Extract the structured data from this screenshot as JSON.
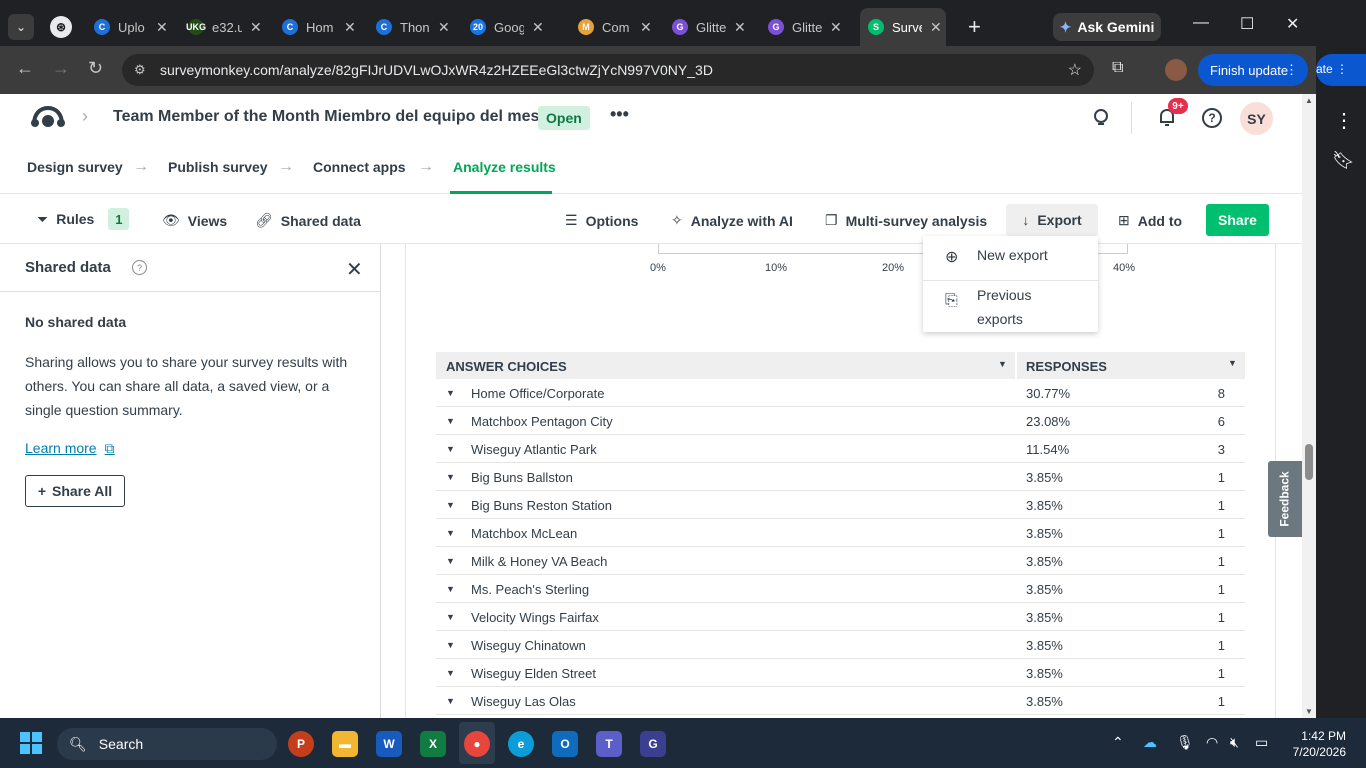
{
  "browser": {
    "tabs": [
      {
        "title": "Uplo",
        "fav_color": "#1e6fd8",
        "fav_glyph": "C"
      },
      {
        "title": "e32.u",
        "fav_color": "#234b1a",
        "fav_glyph": "UKG"
      },
      {
        "title": "Hom",
        "fav_color": "#1e6fd8",
        "fav_glyph": "C"
      },
      {
        "title": "Thon",
        "fav_color": "#1e6fd8",
        "fav_glyph": "C"
      },
      {
        "title": "Goog",
        "fav_color": "#1a73e8",
        "fav_glyph": "20"
      },
      {
        "title": "Com",
        "fav_color": "#e8a13a",
        "fav_glyph": "M"
      },
      {
        "title": "Glitte",
        "fav_color": "#7b4fd6",
        "fav_glyph": "G"
      },
      {
        "title": "Glitte",
        "fav_color": "#7b4fd6",
        "fav_glyph": "G"
      },
      {
        "title": "Surve",
        "fav_color": "#00bf6f",
        "fav_glyph": "S",
        "active": true
      }
    ],
    "gemini_label": "Ask Gemini",
    "url": "surveymonkey.com/analyze/82gFIJrUDVLwOJxWR4z2HZEEeGl3ctwZjYcN997V0NY_3D",
    "finish_update_label": "Finish update",
    "side_update_label": "ate"
  },
  "app": {
    "survey_title": "Team Member of the Month Miembro del equipo del mes",
    "status": "Open",
    "notifications_badge": "9+",
    "avatar_initials": "SY",
    "steps": [
      "Design survey",
      "Publish survey",
      "Connect apps",
      "Analyze results"
    ],
    "toolbar": {
      "rules": "Rules",
      "rules_count": "1",
      "views": "Views",
      "shared_data": "Shared data",
      "options": "Options",
      "analyze_ai": "Analyze with AI",
      "multi_survey": "Multi-survey analysis",
      "export": "Export",
      "add_to": "Add to",
      "share": "Share"
    },
    "export_menu": {
      "new_export": "New export",
      "previous_exports_line1": "Previous",
      "previous_exports_line2": "exports"
    }
  },
  "shared_panel": {
    "title": "Shared data",
    "empty_heading": "No shared data",
    "description": "Sharing allows you to share your survey results with others. You can share all data, a saved view, or a single question summary.",
    "learn_more": "Learn more",
    "share_all": "Share All"
  },
  "chart_axis": {
    "ticks": [
      "0%",
      "10%",
      "20%",
      "40%"
    ]
  },
  "results_table": {
    "col_answer": "ANSWER CHOICES",
    "col_responses": "RESPONSES",
    "rows": [
      {
        "choice": "Home Office/Corporate",
        "pct": "30.77%",
        "count": "8"
      },
      {
        "choice": "Matchbox Pentagon City",
        "pct": "23.08%",
        "count": "6"
      },
      {
        "choice": "Wiseguy Atlantic Park",
        "pct": "11.54%",
        "count": "3"
      },
      {
        "choice": "Big Buns Ballston",
        "pct": "3.85%",
        "count": "1"
      },
      {
        "choice": "Big Buns Reston Station",
        "pct": "3.85%",
        "count": "1"
      },
      {
        "choice": "Matchbox McLean",
        "pct": "3.85%",
        "count": "1"
      },
      {
        "choice": "Milk & Honey VA Beach",
        "pct": "3.85%",
        "count": "1"
      },
      {
        "choice": "Ms. Peach's Sterling",
        "pct": "3.85%",
        "count": "1"
      },
      {
        "choice": "Velocity Wings Fairfax",
        "pct": "3.85%",
        "count": "1"
      },
      {
        "choice": "Wiseguy Chinatown",
        "pct": "3.85%",
        "count": "1"
      },
      {
        "choice": "Wiseguy Elden Street",
        "pct": "3.85%",
        "count": "1"
      },
      {
        "choice": "Wiseguy Las Olas",
        "pct": "3.85%",
        "count": "1"
      }
    ]
  },
  "feedback_label": "Feedback",
  "taskbar": {
    "search_label": "Search",
    "time": "1:42 PM",
    "date": "7/20/2026"
  },
  "colors": {
    "brand_green": "#00bf6f",
    "step_active": "#00a756"
  }
}
